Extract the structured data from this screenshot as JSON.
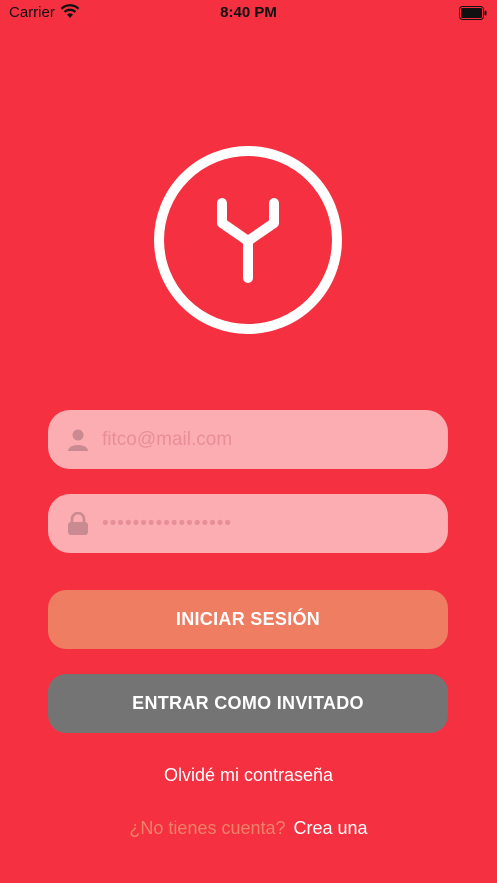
{
  "status_bar": {
    "carrier": "Carrier",
    "time": "8:40 PM"
  },
  "login": {
    "email_placeholder": "fitco@mail.com",
    "password_value": "•••••••••••••••••",
    "login_button": "INICIAR SESIÓN",
    "guest_button": "ENTRAR COMO INVITADO",
    "forgot_password": "Olvidé mi contraseña",
    "no_account": "¿No tienes cuenta?",
    "create_account": "Crea una"
  },
  "colors": {
    "background": "#F43041",
    "field": "#FBADB1",
    "login_button": "#EE7D62",
    "guest_button": "#747474"
  },
  "icons": [
    "wifi-icon",
    "battery-icon",
    "app-logo",
    "user-icon",
    "lock-icon"
  ]
}
